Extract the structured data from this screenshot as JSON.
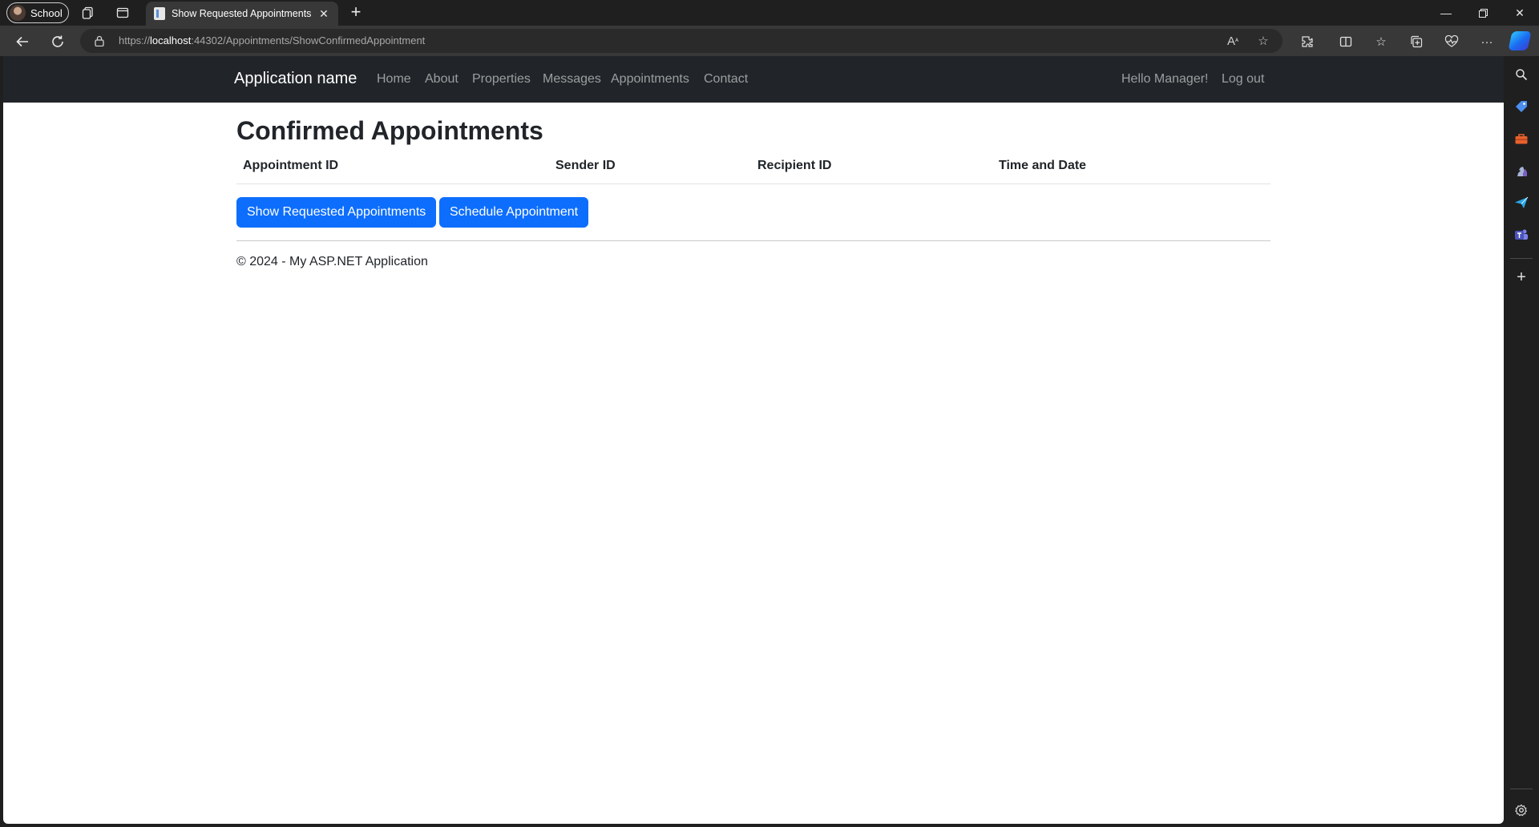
{
  "browser": {
    "profile_label": "School",
    "tab_title": "Show Requested Appointments",
    "url_scheme": "https://",
    "url_host": "localhost",
    "url_path": ":44302/Appointments/ShowConfirmedAppointment"
  },
  "site": {
    "brand": "Application name",
    "nav": [
      "Home",
      "About",
      "Properties",
      "Messages",
      "Appointments",
      "Contact"
    ],
    "greeting": "Hello Manager!",
    "logout": "Log out"
  },
  "main": {
    "title": "Confirmed Appointments",
    "table": {
      "headers": [
        "Appointment ID",
        "Sender ID",
        "Recipient ID",
        "Time and Date"
      ],
      "rows": []
    },
    "buttons": {
      "show_requested": "Show Requested Appointments",
      "schedule": "Schedule Appointment"
    },
    "footer": "© 2024 - My ASP.NET Application"
  },
  "colors": {
    "navbar": "#212529",
    "primary_button": "#0d6efd",
    "chrome_dark": "#1f1f1f",
    "toolbar": "#383838"
  },
  "icons": {
    "sidebar": [
      "search-icon",
      "tag-icon",
      "toolbox-icon",
      "chess-icon",
      "send-icon",
      "teams-icon",
      "add-icon",
      "settings-icon"
    ]
  }
}
